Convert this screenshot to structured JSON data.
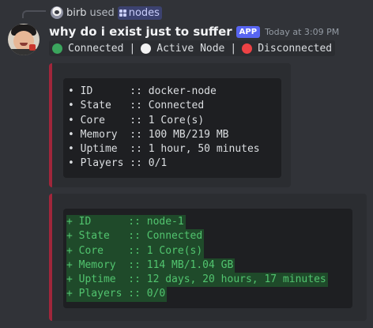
{
  "reply": {
    "username": "birb",
    "used_text": "used",
    "command": "nodes",
    "icon": "grid-icon"
  },
  "message": {
    "username": "why do i exist just to suffer",
    "badge": "APP",
    "timestamp": "Today at 3:09 PM",
    "status_legend": {
      "connected": "Connected",
      "active": "Active Node",
      "disconnected": "Disconnected",
      "separator": "|"
    },
    "colors": {
      "connected": "#3ba55d",
      "active": "#f2f2f2",
      "disconnected": "#ed4245",
      "embed_border": "#a1263b",
      "diff_added": "#52c46f"
    }
  },
  "embeds": [
    {
      "lines": [
        "• ID      :: docker-node",
        "• State   :: Connected",
        "• Core    :: 1 Core(s)",
        "• Memory  :: 100 MB/219 MB",
        "• Uptime  :: 1 hour, 50 minutes",
        "• Players :: 0/1"
      ]
    },
    {
      "lines": [
        "+ ID      :: node-1",
        "+ State   :: Connected",
        "+ Core    :: 1 Core(s)",
        "+ Memory  :: 114 MB/1.04 GB",
        "+ Uptime  :: 12 days, 20 hours, 17 minutes",
        "+ Players :: 0/0"
      ]
    }
  ]
}
